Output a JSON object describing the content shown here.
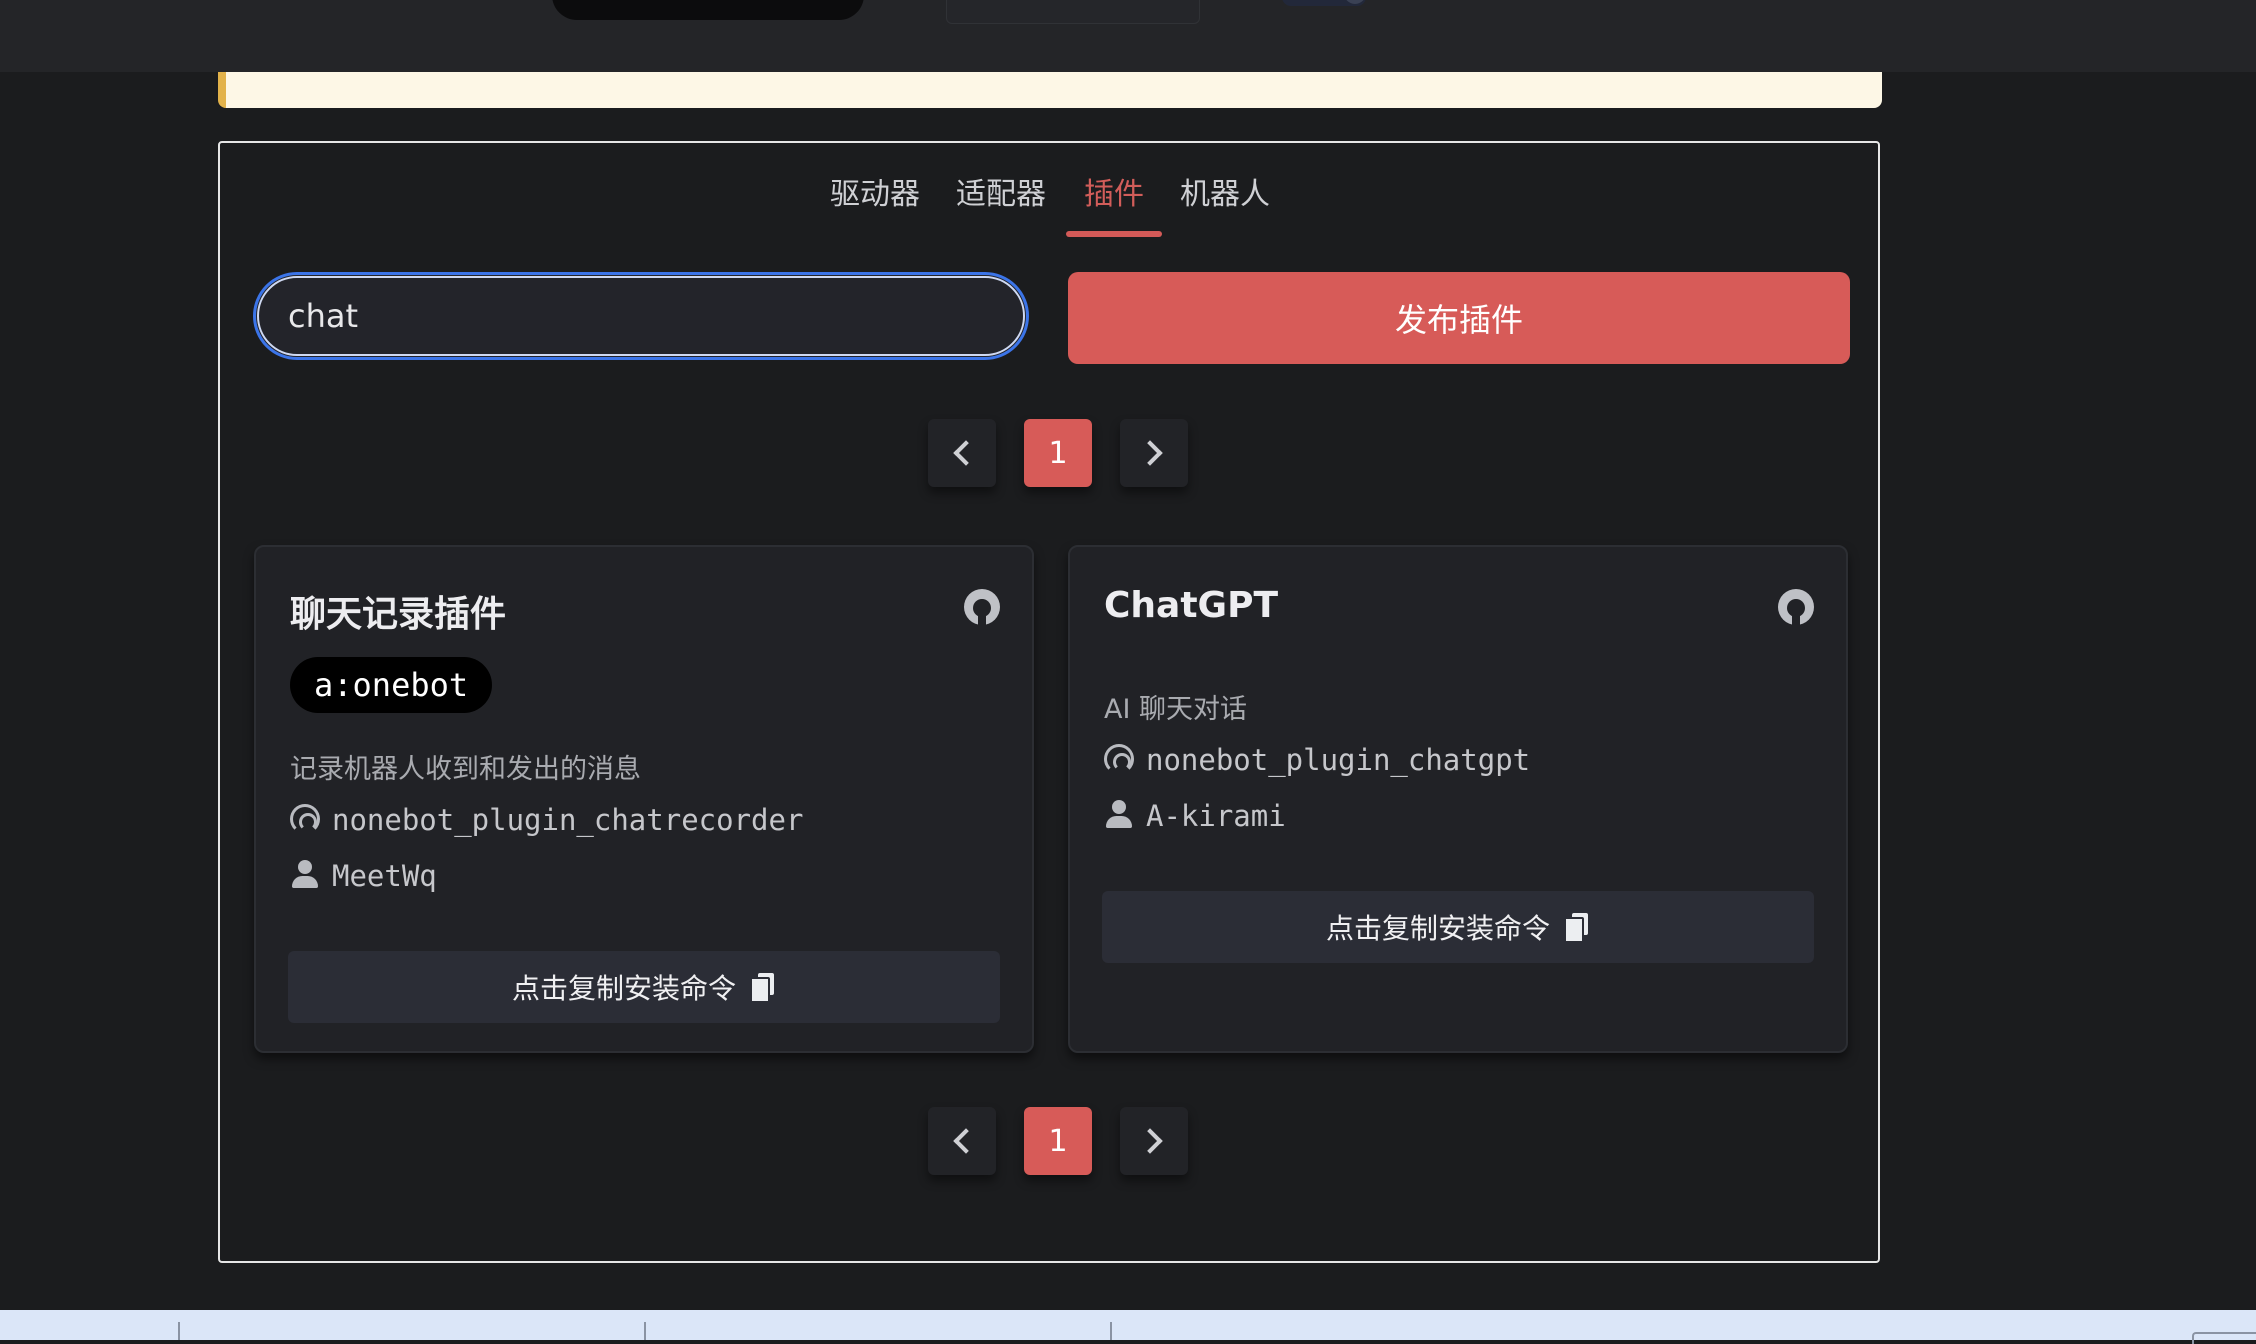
{
  "tabs": [
    {
      "label": "驱动器"
    },
    {
      "label": "适配器"
    },
    {
      "label": "插件"
    },
    {
      "label": "机器人"
    }
  ],
  "active_tab": "插件",
  "search": {
    "value": "chat"
  },
  "publish_button": "发布插件",
  "pagination": {
    "current": "1"
  },
  "cards": [
    {
      "title": "聊天记录插件",
      "tag": "a:onebot",
      "description": "记录机器人收到和发出的消息",
      "module": "nonebot_plugin_chatrecorder",
      "author": "MeetWq",
      "copy_label": "点击复制安装命令"
    },
    {
      "title": "ChatGPT",
      "description": "AI 聊天对话",
      "module": "nonebot_plugin_chatgpt",
      "author": "A-kirami",
      "copy_label": "点击复制安装命令"
    }
  ],
  "colors": {
    "accent": "#d75b58",
    "background": "#1b1c1e",
    "card": "#212226",
    "focus_ring": "#3b74e8",
    "notice": "#fdf7e6"
  }
}
